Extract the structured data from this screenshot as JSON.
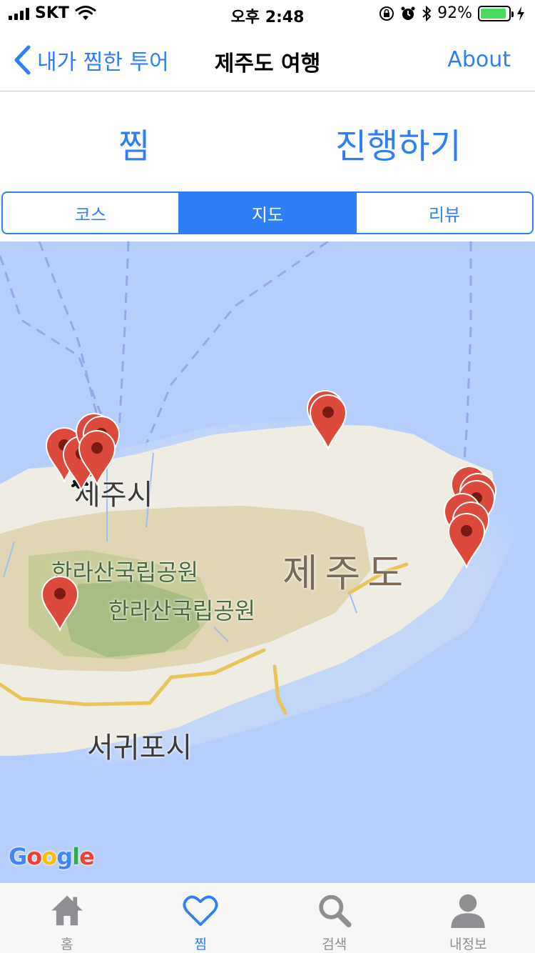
{
  "status_bar": {
    "carrier": "SKT",
    "time": "오후 2:48",
    "battery_percent": "92%",
    "battery_level": 0.92
  },
  "nav": {
    "back_label": "내가 찜한 투어",
    "title": "제주도 여행",
    "right_label": "About"
  },
  "actions": {
    "zzim_label": "찜",
    "proceed_label": "진행하기"
  },
  "segments": [
    {
      "label": "코스",
      "selected": false
    },
    {
      "label": "지도",
      "selected": true
    },
    {
      "label": "리뷰",
      "selected": false
    }
  ],
  "map": {
    "labels": {
      "jeju_city": "제주시",
      "hallasan_1": "한라산국립공원",
      "hallasan_2": "한라산국립공원",
      "island": "제주도",
      "seogwipo": "서귀포시"
    },
    "provider_logo": "Google",
    "marker_color": "#db4a3c",
    "marker_count": 14
  },
  "tabs": [
    {
      "label": "홈",
      "icon": "home-icon",
      "active": false
    },
    {
      "label": "찜",
      "icon": "heart-icon",
      "active": true
    },
    {
      "label": "검색",
      "icon": "search-icon",
      "active": false
    },
    {
      "label": "내정보",
      "icon": "person-icon",
      "active": false
    }
  ],
  "colors": {
    "accent": "#2f7ef6",
    "map_sea": "#b6cffa",
    "inactive_tab": "#8e8e93"
  }
}
